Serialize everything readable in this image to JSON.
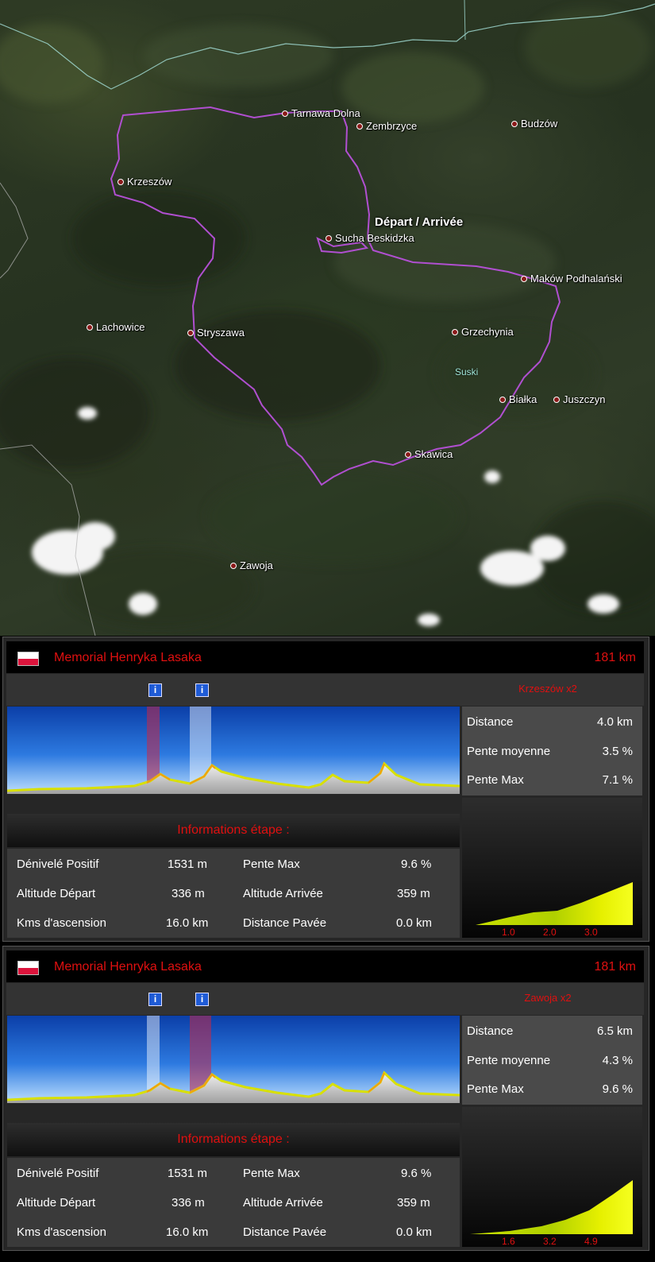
{
  "map": {
    "towns": [
      {
        "name": "Tarnawa Dolna"
      },
      {
        "name": "Zembrzyce"
      },
      {
        "name": "Budzów"
      },
      {
        "name": "Krzeszów"
      },
      {
        "name": "Sucha Beskidzka"
      },
      {
        "name": "Maków Podhalański"
      },
      {
        "name": "Lachowice"
      },
      {
        "name": "Stryszawa"
      },
      {
        "name": "Grzechynia"
      },
      {
        "name": "Białka"
      },
      {
        "name": "Juszczyn"
      },
      {
        "name": "Skawica"
      },
      {
        "name": "Zawoja"
      }
    ],
    "start_label": "Départ / Arrivée",
    "region_label": "Suski",
    "route_color": "#b04fd0"
  },
  "panels": [
    {
      "flag": "poland-flag",
      "race_name": "Memorial Henryka Lasaka",
      "total_distance": "181 km",
      "climb_name": "Krzeszów x2",
      "info_icon": "info-icon",
      "highlight_order": [
        "red",
        "white"
      ],
      "stats": [
        {
          "label": "Distance",
          "value": "4.0 km"
        },
        {
          "label": "Pente moyenne",
          "value": "3.5 %"
        },
        {
          "label": "Pente Max",
          "value": "7.1 %"
        }
      ],
      "info_title": "Informations étape :",
      "info": {
        "denivele_label": "Dénivelé Positif",
        "denivele_value": "1531 m",
        "pente_max_label": "Pente Max",
        "pente_max_value": "9.6 %",
        "alt_depart_label": "Altitude Départ",
        "alt_depart_value": "336 m",
        "alt_arrivee_label": "Altitude Arrivée",
        "alt_arrivee_value": "359 m",
        "kms_label": "Kms d'ascension",
        "kms_value": "16.0 km",
        "pavee_label": "Distance Pavée",
        "pavee_value": "0.0 km"
      },
      "mini_ticks": [
        "1.0",
        "2.0",
        "3.0"
      ]
    },
    {
      "flag": "poland-flag",
      "race_name": "Memorial Henryka Lasaka",
      "total_distance": "181 km",
      "climb_name": "Zawoja x2",
      "info_icon": "info-icon",
      "highlight_order": [
        "white",
        "red"
      ],
      "stats": [
        {
          "label": "Distance",
          "value": "6.5 km"
        },
        {
          "label": "Pente moyenne",
          "value": "4.3 %"
        },
        {
          "label": "Pente Max",
          "value": "9.6 %"
        }
      ],
      "info_title": "Informations étape :",
      "info": {
        "denivele_label": "Dénivelé Positif",
        "denivele_value": "1531 m",
        "pente_max_label": "Pente Max",
        "pente_max_value": "9.6 %",
        "alt_depart_label": "Altitude Départ",
        "alt_depart_value": "336 m",
        "alt_arrivee_label": "Altitude Arrivée",
        "alt_arrivee_value": "359 m",
        "kms_label": "Kms d'ascension",
        "kms_value": "16.0 km",
        "pavee_label": "Distance Pavée",
        "pavee_value": "0.0 km"
      },
      "mini_ticks": [
        "1.6",
        "3.2",
        "4.9"
      ]
    }
  ]
}
